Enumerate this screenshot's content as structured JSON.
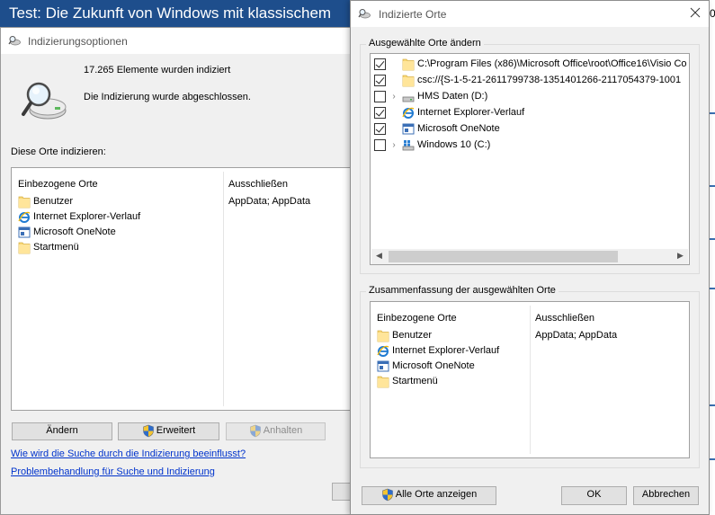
{
  "background": {
    "article_title": "Test: Die Zukunft von Windows mit klassischem",
    "right_edge_glyph": "0"
  },
  "main_window": {
    "title": "Indizierungsoptionen",
    "items_count_text": "17.265 Elemente wurden indiziert",
    "status_text": "Die Indizierung wurde abgeschlossen.",
    "locations_label": "Diese Orte indizieren:",
    "columns": {
      "included": "Einbezogene Orte",
      "excluded": "Ausschließen"
    },
    "rows": [
      {
        "name": "Benutzer",
        "icon": "folder-icon",
        "exclude": "AppData; AppData"
      },
      {
        "name": "Internet Explorer-Verlauf",
        "icon": "ie-icon",
        "exclude": ""
      },
      {
        "name": "Microsoft OneNote",
        "icon": "onenote-icon",
        "exclude": ""
      },
      {
        "name": "Startmenü",
        "icon": "folder-icon",
        "exclude": ""
      }
    ],
    "buttons": {
      "modify": "Ändern",
      "advanced": "Erweitert",
      "pause": "Anhalten"
    },
    "links": {
      "how_affects": "Wie wird die Suche durch die Indizierung beeinflusst?",
      "troubleshoot": "Problembehandlung für Suche und Indizierung"
    }
  },
  "dialog": {
    "title": "Indizierte Orte",
    "group_change": "Ausgewählte Orte ändern",
    "tree": [
      {
        "label": "C:\\Program Files (x86)\\Microsoft Office\\root\\Office16\\Visio Co",
        "checked": true,
        "expandable": false,
        "icon": "folder-icon"
      },
      {
        "label": "csc://{S-1-5-21-2611799738-1351401266-2117054379-1001",
        "checked": true,
        "expandable": false,
        "icon": "folder-icon"
      },
      {
        "label": "HMS Daten (D:)",
        "checked": false,
        "expandable": true,
        "icon": "drive-icon"
      },
      {
        "label": "Internet Explorer-Verlauf",
        "checked": true,
        "expandable": false,
        "icon": "ie-icon"
      },
      {
        "label": "Microsoft OneNote",
        "checked": true,
        "expandable": false,
        "icon": "onenote-icon"
      },
      {
        "label": "Windows 10 (C:)",
        "checked": false,
        "expandable": true,
        "icon": "windows-drive-icon"
      }
    ],
    "group_summary": "Zusammenfassung der ausgewählten Orte",
    "summary_columns": {
      "included": "Einbezogene Orte",
      "excluded": "Ausschließen"
    },
    "summary_rows": [
      {
        "name": "Benutzer",
        "icon": "folder-icon",
        "exclude": "AppData; AppData"
      },
      {
        "name": "Internet Explorer-Verlauf",
        "icon": "ie-icon",
        "exclude": ""
      },
      {
        "name": "Microsoft OneNote",
        "icon": "onenote-icon",
        "exclude": ""
      },
      {
        "name": "Startmenü",
        "icon": "folder-icon",
        "exclude": ""
      }
    ],
    "buttons": {
      "show_all": "Alle Orte anzeigen",
      "ok": "OK",
      "cancel": "Abbrechen"
    }
  },
  "colors": {
    "link": "#0033cc",
    "titlebar_bg": "#ffffff",
    "window_bg": "#f0f0f0",
    "article_header": "#1e4e8c"
  }
}
